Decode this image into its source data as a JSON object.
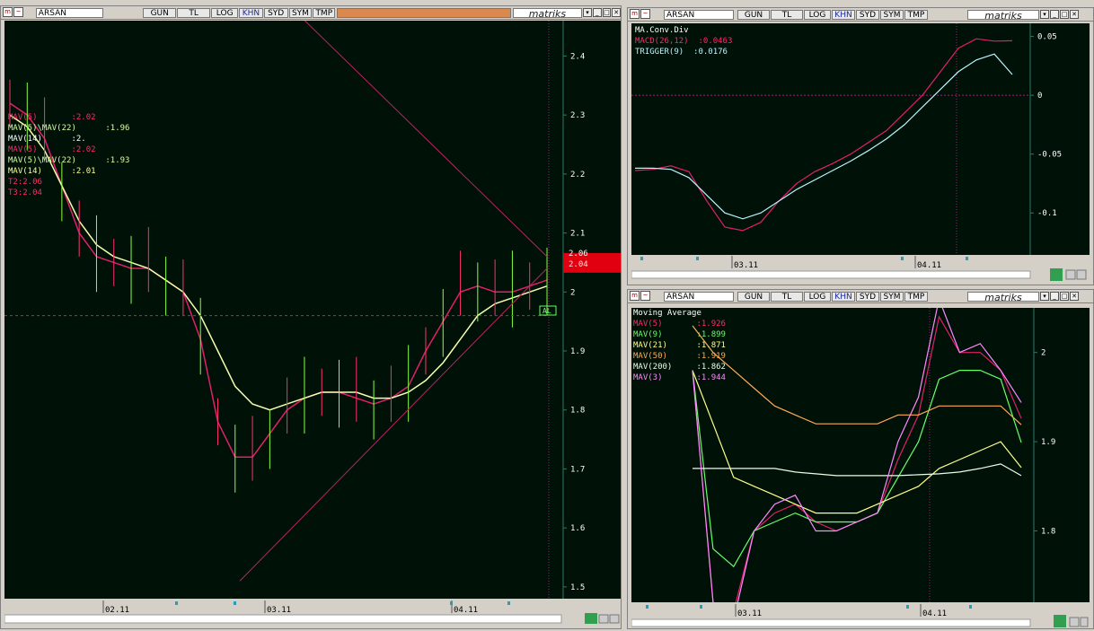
{
  "windows": [
    {
      "symbol": "ARSAN",
      "buttons": [
        "GUN",
        "TL",
        "LOG",
        "KHN",
        "SYD",
        "SYM",
        "TMP"
      ],
      "brand": "matriks"
    },
    {
      "symbol": "ARSAN",
      "buttons": [
        "GUN",
        "TL",
        "LOG",
        "KHN",
        "SYD",
        "SYM",
        "TMP"
      ],
      "brand": "matriks"
    },
    {
      "symbol": "ARSAN",
      "buttons": [
        "GUN",
        "TL",
        "LOG",
        "KHN",
        "SYD",
        "SYM",
        "TMP"
      ],
      "brand": "matriks"
    }
  ],
  "main_legend": [
    {
      "text": "MAV(5)       :2.02",
      "color": "#ff2a6a"
    },
    {
      "text": "MAV(5)\\MAV(22)      :1.96",
      "color": "#d8ff9a"
    },
    {
      "text": "MAV(14)      :2.",
      "color": "#ffffff"
    },
    {
      "text": "MAV(5)       :2.02",
      "color": "#ff2a6a"
    },
    {
      "text": "MAV(5)\\MAV(22)      :1.93",
      "color": "#d8ff9a"
    },
    {
      "text": "MAV(14)      :2.01",
      "color": "#ffff88"
    },
    {
      "text": "T2:2.06",
      "color": "#ff2a6a"
    },
    {
      "text": "T3:2.04",
      "color": "#ff2a6a"
    }
  ],
  "main_marker": "AL",
  "price_box": {
    "label_top": "2.06",
    "label_bottom": "2.04"
  },
  "macd_legend": [
    {
      "text": "MA.Conv.Div",
      "color": "#ffffff"
    },
    {
      "text": "MACD(26,12)  :0.0463",
      "color": "#ff2a6a"
    },
    {
      "text": "TRIGGER(9)  :0.0176",
      "color": "#b8f4ff"
    }
  ],
  "ma_legend": [
    {
      "text": "Moving Average",
      "color": "#ffffff"
    },
    {
      "text": "MAV(5)       :1.926",
      "color": "#ff2a6a"
    },
    {
      "text": "MAV(9)       :1.899",
      "color": "#66ff66"
    },
    {
      "text": "MAV(21)      :1.871",
      "color": "#ffff88"
    },
    {
      "text": "MAV(50)      :1.919",
      "color": "#ffaa55"
    },
    {
      "text": "MAV(200)     :1.862",
      "color": "#e8ffe8"
    },
    {
      "text": "MAV(3)       :1.944",
      "color": "#ff88ff"
    }
  ],
  "chart_data": [
    {
      "type": "line",
      "subtype": "candlestick-ohlc",
      "x_labels": [
        "02.11",
        "03.11",
        "04.11"
      ],
      "y_ticks": [
        1.5,
        1.6,
        1.7,
        1.8,
        1.9,
        2,
        2.1,
        2.2,
        2.3,
        2.4
      ],
      "ylim": [
        1.48,
        2.46
      ],
      "series": [
        {
          "name": "MAV(5)",
          "values": [
            2.32,
            2.3,
            2.26,
            2.18,
            2.1,
            2.06,
            2.05,
            2.04,
            2.04,
            2.02,
            2.0,
            1.92,
            1.78,
            1.72,
            1.72,
            1.76,
            1.8,
            1.82,
            1.83,
            1.83,
            1.82,
            1.81,
            1.82,
            1.84,
            1.9,
            1.95,
            2.0,
            2.01,
            2.0,
            2.0,
            2.01,
            2.02
          ]
        },
        {
          "name": "MAV(14)",
          "values": [
            2.3,
            2.28,
            2.24,
            2.18,
            2.12,
            2.08,
            2.06,
            2.05,
            2.04,
            2.02,
            2.0,
            1.96,
            1.9,
            1.84,
            1.81,
            1.8,
            1.81,
            1.82,
            1.83,
            1.83,
            1.83,
            1.82,
            1.82,
            1.83,
            1.85,
            1.88,
            1.92,
            1.96,
            1.98,
            1.99,
            2.0,
            2.01
          ]
        }
      ],
      "trendlines": [
        {
          "name": "T2",
          "value": 2.06
        },
        {
          "name": "T3",
          "value": 2.04
        }
      ]
    },
    {
      "type": "line",
      "title": "MA.Conv.Div",
      "x_labels": [
        "03.11",
        "04.11"
      ],
      "y_ticks": [
        0.05,
        0,
        -0.05,
        -0.1
      ],
      "ylim": [
        -0.125,
        0.055
      ],
      "series": [
        {
          "name": "MACD(26,12)",
          "values": [
            -0.064,
            -0.063,
            -0.06,
            -0.065,
            -0.09,
            -0.112,
            -0.115,
            -0.108,
            -0.09,
            -0.075,
            -0.065,
            -0.058,
            -0.05,
            -0.04,
            -0.03,
            -0.015,
            0.0,
            0.02,
            0.04,
            0.048,
            0.046,
            0.0463
          ]
        },
        {
          "name": "TRIGGER(9)",
          "values": [
            -0.062,
            -0.062,
            -0.063,
            -0.07,
            -0.085,
            -0.1,
            -0.105,
            -0.1,
            -0.09,
            -0.08,
            -0.072,
            -0.064,
            -0.056,
            -0.047,
            -0.037,
            -0.025,
            -0.01,
            0.005,
            0.02,
            0.03,
            0.035,
            0.0176
          ]
        }
      ]
    },
    {
      "type": "line",
      "title": "Moving Average",
      "x_labels": [
        "03.11",
        "04.11"
      ],
      "y_ticks": [
        2,
        1.9,
        1.8
      ],
      "ylim": [
        1.72,
        2.05
      ],
      "series": [
        {
          "name": "MAV(5)",
          "values": [
            1.98,
            1.72,
            1.71,
            1.8,
            1.82,
            1.83,
            1.81,
            1.8,
            1.81,
            1.82,
            1.88,
            1.93,
            2.04,
            2.0,
            2.0,
            1.98,
            1.926
          ]
        },
        {
          "name": "MAV(9)",
          "values": [
            1.98,
            1.78,
            1.76,
            1.8,
            1.81,
            1.82,
            1.81,
            1.81,
            1.81,
            1.82,
            1.86,
            1.9,
            1.97,
            1.98,
            1.98,
            1.97,
            1.899
          ]
        },
        {
          "name": "MAV(21)",
          "values": [
            1.98,
            1.92,
            1.86,
            1.85,
            1.84,
            1.83,
            1.82,
            1.82,
            1.82,
            1.83,
            1.84,
            1.85,
            1.87,
            1.88,
            1.89,
            1.9,
            1.871
          ]
        },
        {
          "name": "MAV(50)",
          "values": [
            2.03,
            2.0,
            1.98,
            1.96,
            1.94,
            1.93,
            1.92,
            1.92,
            1.92,
            1.92,
            1.93,
            1.93,
            1.94,
            1.94,
            1.94,
            1.94,
            1.919
          ]
        },
        {
          "name": "MAV(200)",
          "values": [
            1.87,
            1.87,
            1.87,
            1.87,
            1.87,
            1.866,
            1.864,
            1.862,
            1.862,
            1.862,
            1.862,
            1.863,
            1.864,
            1.866,
            1.87,
            1.875,
            1.862
          ]
        },
        {
          "name": "MAV(3)",
          "values": [
            1.98,
            1.72,
            1.7,
            1.8,
            1.83,
            1.84,
            1.8,
            1.8,
            1.81,
            1.82,
            1.9,
            1.95,
            2.06,
            2.0,
            2.01,
            1.98,
            1.944
          ]
        }
      ]
    }
  ]
}
